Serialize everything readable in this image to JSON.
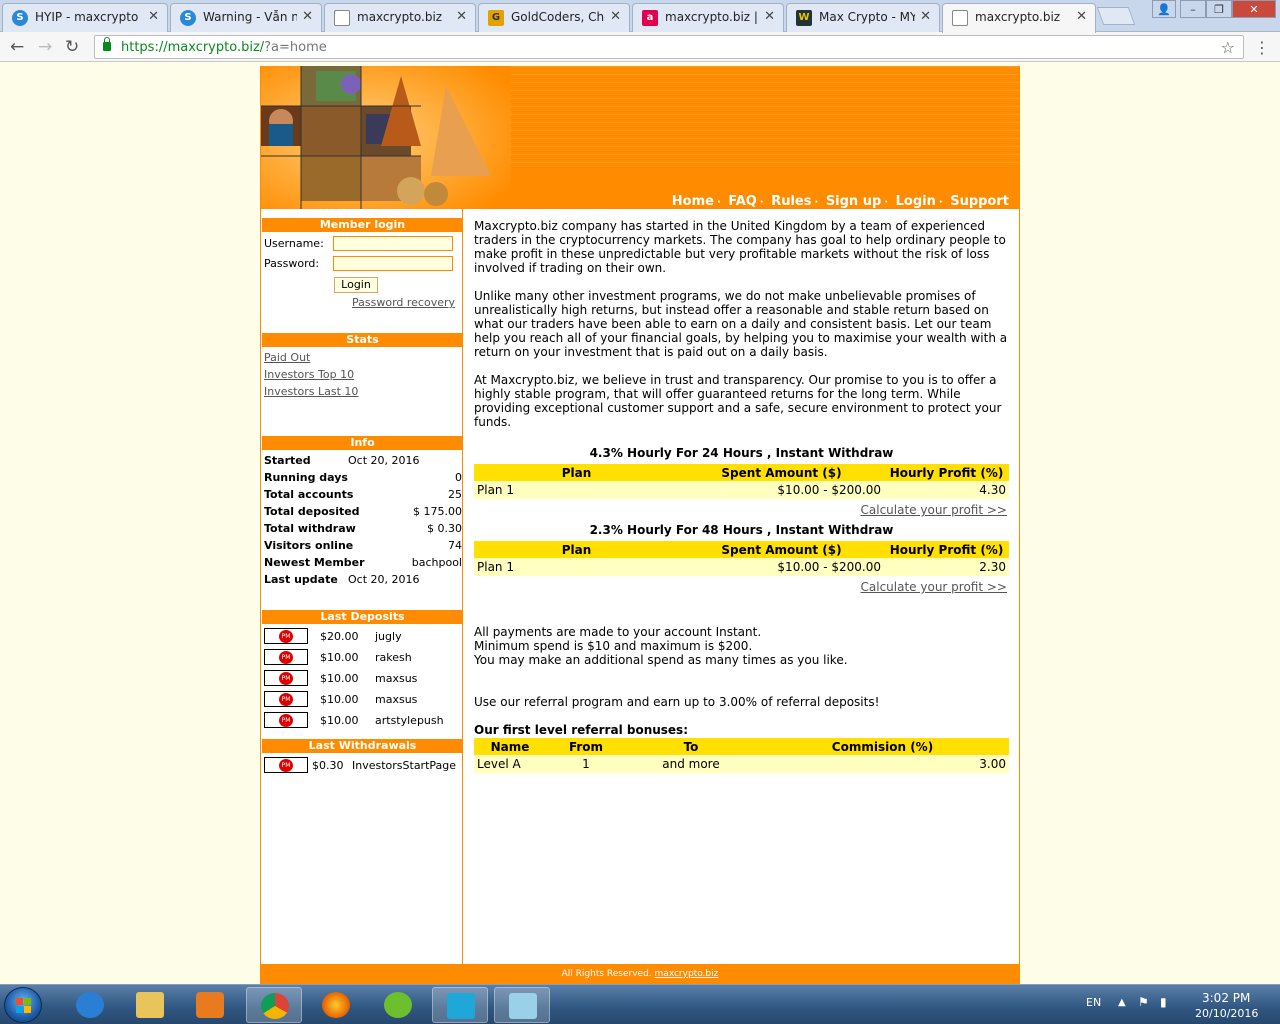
{
  "browser": {
    "tabs": [
      {
        "title": "HYIP - maxcrypto",
        "favicon": "skype-icon",
        "active": false
      },
      {
        "title": "Warning - Vẫn nạp",
        "favicon": "skype-icon",
        "active": false
      },
      {
        "title": "maxcrypto.biz",
        "favicon": "page-icon",
        "active": false
      },
      {
        "title": "GoldCoders, Chec",
        "favicon": "goldcoders-icon",
        "active": false
      },
      {
        "title": "maxcrypto.biz | M",
        "favicon": "a-icon",
        "active": false
      },
      {
        "title": "Max Crypto - MYI",
        "favicon": "w-icon",
        "active": false
      },
      {
        "title": "maxcrypto.biz",
        "favicon": "page-icon",
        "active": true
      }
    ],
    "url_host": "https://maxcrypto.biz/",
    "url_rest": "?a=home"
  },
  "nav": {
    "items": [
      "Home",
      "FAQ",
      "Rules",
      "Sign up",
      "Login",
      "Support"
    ],
    "sep": "·"
  },
  "login": {
    "title": "Member login",
    "username_label": "Username:",
    "password_label": "Password:",
    "button": "Login",
    "recovery": "Password recovery"
  },
  "stats": {
    "title": "Stats",
    "links": [
      "Paid Out",
      "Investors Top 10",
      "Investors Last 10"
    ]
  },
  "info": {
    "title": "Info",
    "rows": [
      {
        "k": "Started",
        "v": "Oct 20, 2016"
      },
      {
        "k": "Running days",
        "v": "0"
      },
      {
        "k": "Total accounts",
        "v": "25"
      },
      {
        "k": "Total deposited",
        "v": "$ 175.00"
      },
      {
        "k": "Total withdraw",
        "v": "$ 0.30"
      },
      {
        "k": "Visitors online",
        "v": "74"
      },
      {
        "k": "Newest Member",
        "v": "bachpool"
      },
      {
        "k": "Last update",
        "v": "Oct 20, 2016"
      }
    ]
  },
  "deposits": {
    "title": "Last Deposits",
    "rows": [
      {
        "amount": "$20.00",
        "user": "jugly"
      },
      {
        "amount": "$10.00",
        "user": "rakesh"
      },
      {
        "amount": "$10.00",
        "user": "maxsus"
      },
      {
        "amount": "$10.00",
        "user": "maxsus"
      },
      {
        "amount": "$10.00",
        "user": "artstylepush"
      }
    ],
    "badge": "PM"
  },
  "withdrawals": {
    "title": "Last Withdrawals",
    "rows": [
      {
        "amount": "$0.30",
        "user": "InvestorsStartPage"
      }
    ]
  },
  "content": {
    "p1": "Maxcrypto.biz company has started in the United Kingdom by a team of experienced traders in the cryptocurrency markets. The company has goal to help ordinary people to make profit in these unpredictable but very profitable markets without the risk of loss involved if trading on their own.",
    "p2": "Unlike many other investment programs, we do not make unbelievable promises of unrealistically high returns, but instead offer a reasonable and stable return based on what our traders have been able to earn on a daily and consistent basis. Let our team help you reach all of your financial goals, by helping you to maximise your wealth with a return on your investment that is paid out on a daily basis.",
    "p3": "At Maxcrypto.biz, we believe in trust and transparency. Our promise to you is to offer a highly stable program, that will offer guaranteed returns for the long term. While providing exceptional customer support and a safe, secure environment to protect your funds.",
    "plan_headers": [
      "Plan",
      "Spent Amount ($)",
      "Hourly Profit (%)"
    ],
    "plans": [
      {
        "title": "4.3% Hourly For 24 Hours , Instant Withdraw",
        "name": "Plan 1",
        "amount": "$10.00 - $200.00",
        "profit": "4.30"
      },
      {
        "title": "2.3% Hourly For 48 Hours , Instant Withdraw",
        "name": "Plan 1",
        "amount": "$10.00 - $200.00",
        "profit": "2.30"
      }
    ],
    "calc": "Calculate your profit >>",
    "pay1": "All payments are made to your account Instant.",
    "pay2": "Minimum spend is $10 and maximum is $200.",
    "pay3": "You may make an additional spend as many times as you like.",
    "ref_line": "Use our referral program and earn up to 3.00% of referral deposits!",
    "ref_title": "Our first level referral bonuses:",
    "ref_headers": [
      "Name",
      "From",
      "To",
      "Commision (%)"
    ],
    "ref_row": {
      "name": "Level A",
      "from": "1",
      "to": "and more",
      "commission": "3.00"
    }
  },
  "footer": {
    "text": "All Rights Reserved.",
    "link": "maxcrypto.biz"
  },
  "taskbar": {
    "lang": "EN",
    "time": "3:02 PM",
    "date": "20/10/2016"
  },
  "colors": {
    "accent": "#ff8c00",
    "table_header": "#ffe000",
    "table_cell": "#ffffc0"
  }
}
